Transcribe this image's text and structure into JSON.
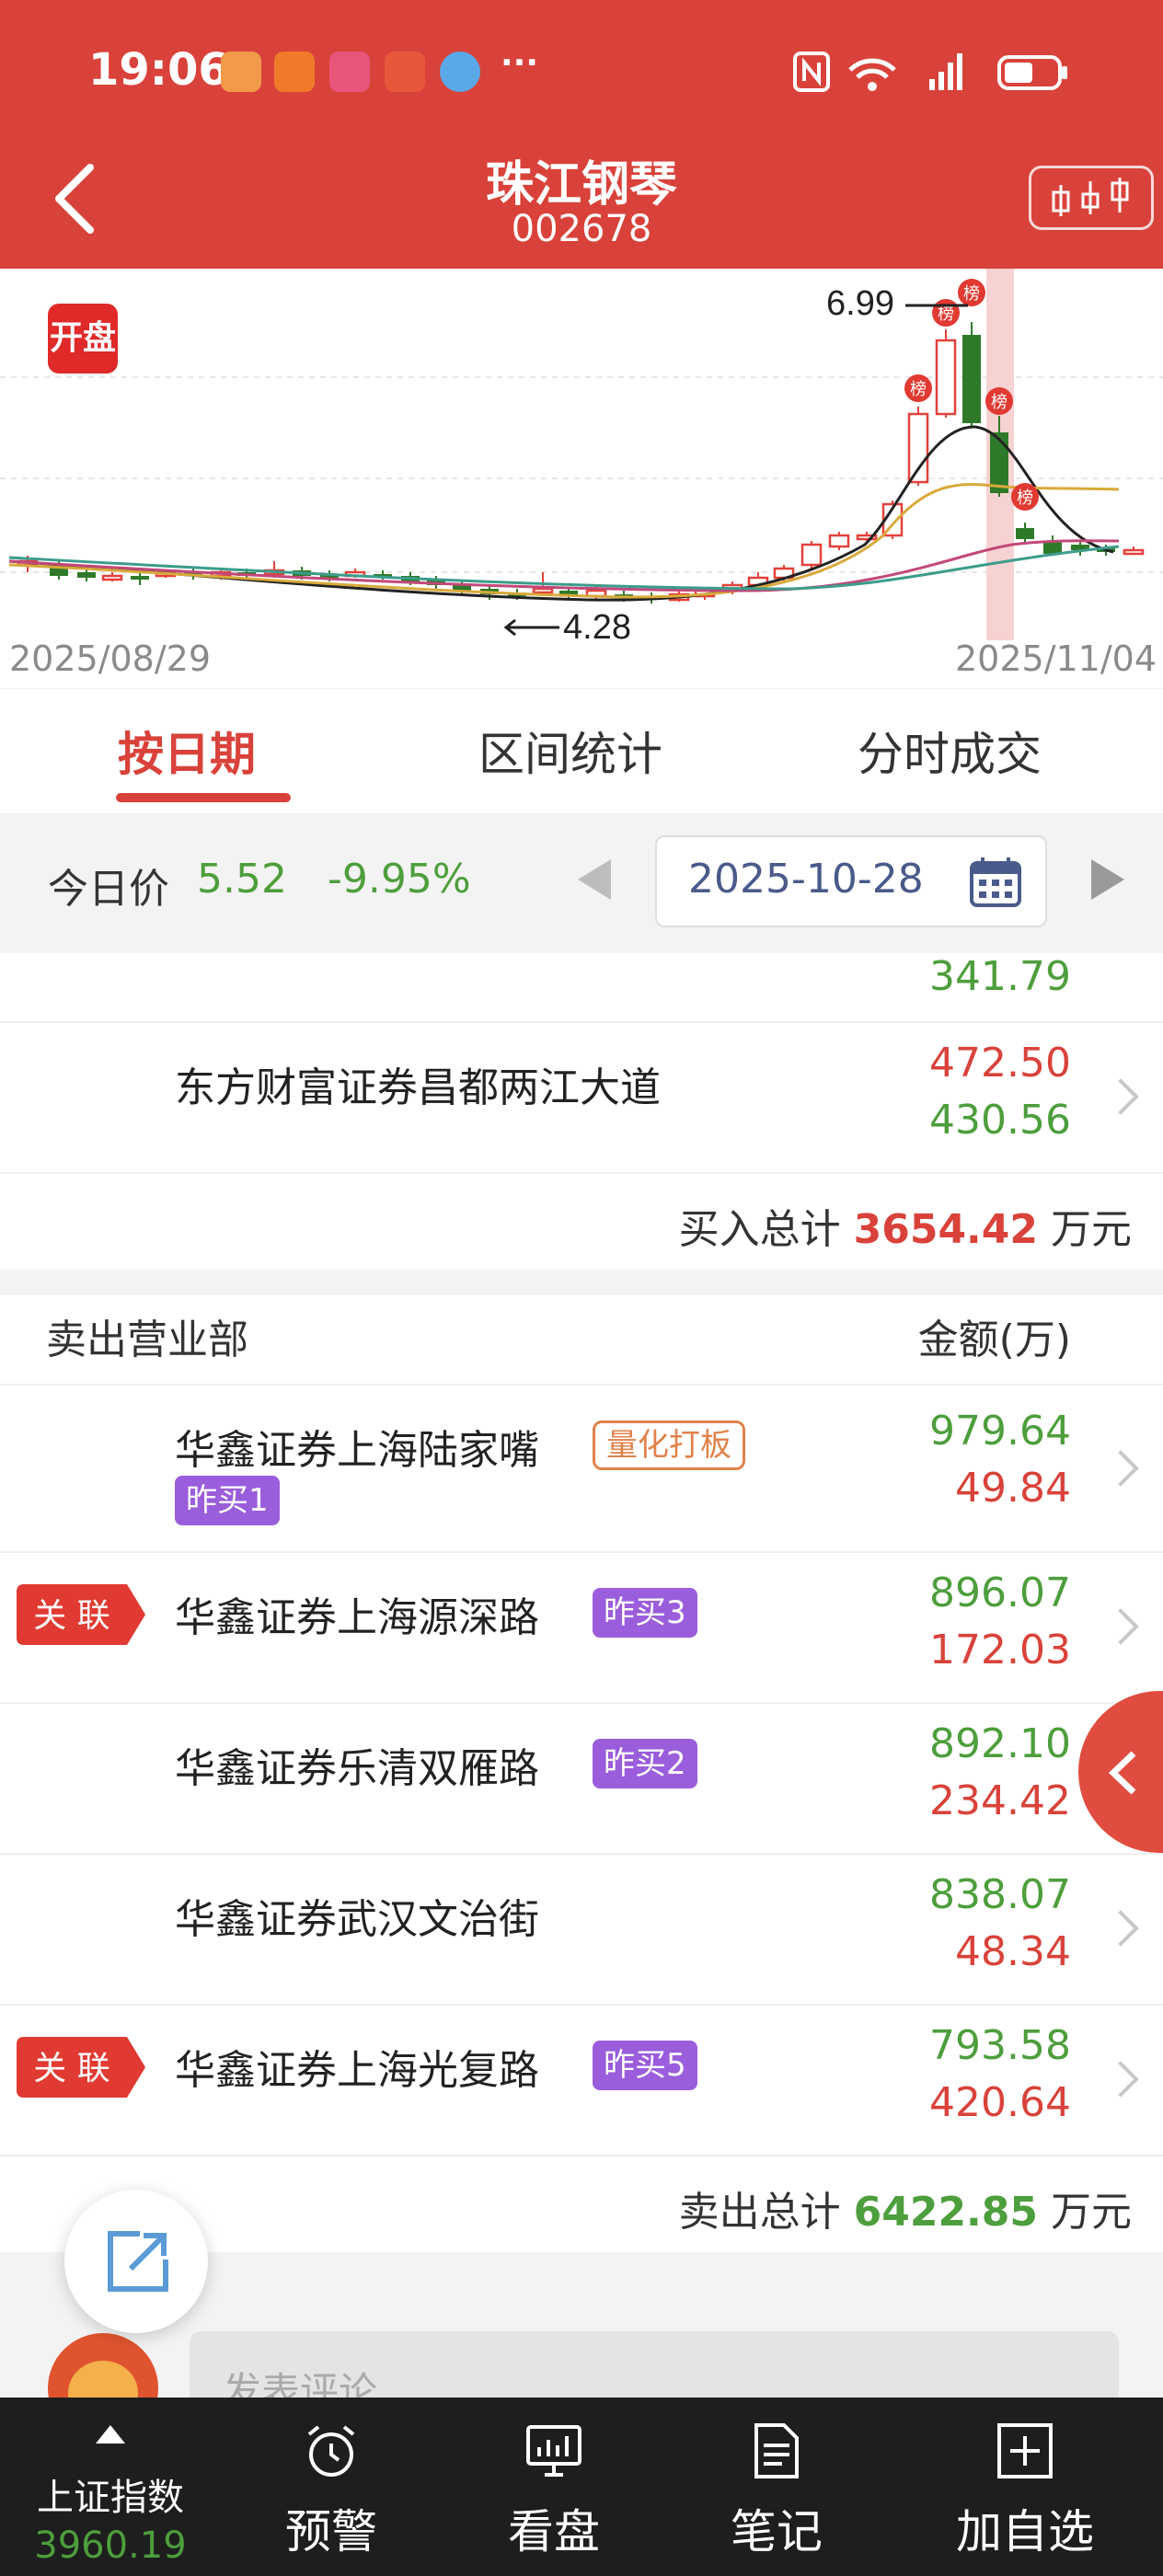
{
  "status": {
    "time": "19:06",
    "more": "···"
  },
  "header": {
    "title": "珠江钢琴",
    "code": "002678"
  },
  "chart": {
    "open_badge": "开盘",
    "high_label": "6.99",
    "low_label": "4.28",
    "date_start": "2025/08/29",
    "date_end": "2025/11/04",
    "list_badge": "榜",
    "colors": {
      "up": "#e3413a",
      "down": "#2f7a2a",
      "ma5": "#222222",
      "ma10": "#d9a93a",
      "ma20": "#c2497a",
      "ma60": "#3c9c8c"
    }
  },
  "chart_data": {
    "type": "candlestick",
    "x_start": "2025/08/29",
    "x_end": "2025/11/04",
    "annotated_high": 6.99,
    "annotated_low": 4.28
  },
  "tabs": [
    {
      "label": "按日期"
    },
    {
      "label": "区间统计"
    },
    {
      "label": "分时成交"
    }
  ],
  "price": {
    "label": "今日价",
    "value": "5.52",
    "change": "-9.95%",
    "date": "2025-10-28"
  },
  "buy": {
    "partial_value": "341.79",
    "row": {
      "name": "东方财富证券昌都两江大道",
      "v1": "472.50",
      "v2": "430.56"
    },
    "total_label": "买入总计",
    "total_value": "3654.42",
    "total_unit": "万元"
  },
  "sell": {
    "header_left": "卖出营业部",
    "header_right": "金额(万)",
    "related_label": "关 联",
    "rows": [
      {
        "name": "华鑫证券上海陆家嘴",
        "tag1": "量化打板",
        "tag2": "昨买1",
        "v1": "979.64",
        "v2": "49.84"
      },
      {
        "name": "华鑫证券上海源深路",
        "tag2": "昨买3",
        "v1": "896.07",
        "v2": "172.03"
      },
      {
        "name": "华鑫证券乐清双雁路",
        "tag2": "昨买2",
        "v1": "892.10",
        "v2": "234.42"
      },
      {
        "name": "华鑫证券武汉文治街",
        "v1": "838.07",
        "v2": "48.34"
      },
      {
        "name": "华鑫证券上海光复路",
        "tag2": "昨买5",
        "v1": "793.58",
        "v2": "420.64"
      }
    ],
    "total_label": "卖出总计",
    "total_value": "6422.85",
    "total_unit": "万元"
  },
  "comment": {
    "placeholder": "发表评论"
  },
  "nav": [
    {
      "label": "上证指数",
      "value": "3960.19"
    },
    {
      "label": "预警"
    },
    {
      "label": "看盘"
    },
    {
      "label": "笔记"
    },
    {
      "label": "加自选"
    }
  ]
}
